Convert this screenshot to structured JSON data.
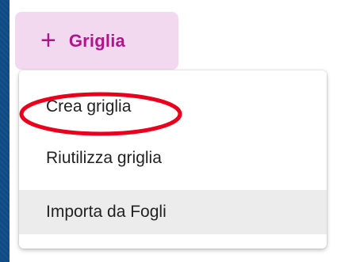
{
  "toolbar": {
    "add_button": {
      "icon": "plus-icon",
      "label": "Griglia",
      "background": "#f3d9f0",
      "color": "#b0168a"
    }
  },
  "menu": {
    "items": [
      {
        "label": "Crea griglia",
        "highlighted": true
      },
      {
        "label": "Riutilizza griglia"
      },
      {
        "label": "Importa da Fogli",
        "hovered": true
      }
    ]
  },
  "annotation": {
    "highlight_color": "#e8001c"
  },
  "background": {
    "color": "#0f4c86"
  }
}
